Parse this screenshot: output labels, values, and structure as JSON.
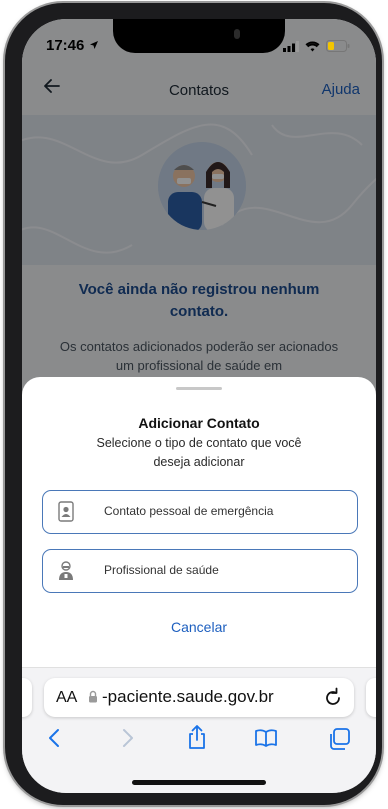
{
  "status_bar": {
    "time": "17:46"
  },
  "header": {
    "title": "Contatos",
    "help_label": "Ajuda"
  },
  "empty_state": {
    "title": "Você ainda não registrou nenhum contato.",
    "description": "Os contatos adicionados poderão ser acionados um profissional de saúde em"
  },
  "sheet": {
    "title": "Adicionar Contato",
    "subtitle": "Selecione o tipo de contato que você deseja adicionar",
    "options": [
      {
        "label": "Contato pessoal de emergência",
        "icon": "contact-card-icon"
      },
      {
        "label": "Profissional de saúde",
        "icon": "health-professional-icon"
      }
    ],
    "cancel_label": "Cancelar"
  },
  "browser": {
    "text_size_label": "AA",
    "url": "-paciente.saude.gov.br",
    "icons": [
      "back-icon",
      "forward-icon",
      "share-icon",
      "bookmarks-icon",
      "tabs-icon"
    ]
  },
  "colors": {
    "accent": "#1d5fbf",
    "heading": "#1d4c8f",
    "option_border": "#4a78b8"
  }
}
